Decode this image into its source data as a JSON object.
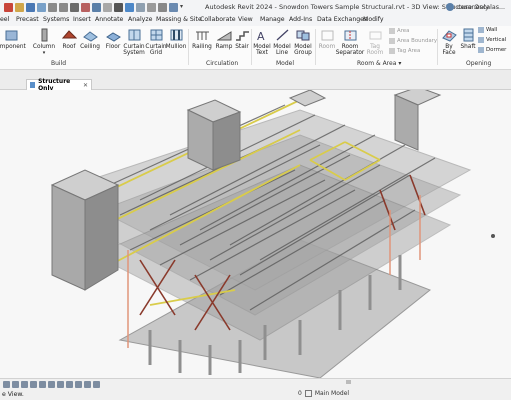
{
  "window": {
    "title": "Autodesk Revit 2024 - Snowdon Towers Sample Structural.rvt - 3D View: Structure Only",
    "user": "cesar.escalas..."
  },
  "menu": {
    "items": [
      "eel",
      "Precast",
      "Systems",
      "Insert",
      "Annotate",
      "Analyze",
      "Massing & Site",
      "Collaborate",
      "View",
      "Manage",
      "Add-Ins",
      "Modify"
    ],
    "data_exchanges": "Data Exchanges"
  },
  "ribbon": {
    "component": "omponent",
    "column": "Column",
    "roof": "Roof",
    "ceiling": "Ceiling",
    "floor": "Floor",
    "curtain_system": "Curtain System",
    "curtain_grid": "Curtain Grid",
    "mullion": "Mullion",
    "railing": "Railing",
    "ramp": "Ramp",
    "stair": "Stair",
    "model_text": "Model Text",
    "model_line": "Model Line",
    "model_group": "Model Group",
    "room": "Room",
    "room_separator": "Room Separator",
    "tag_room": "Tag Room",
    "area": "Area",
    "area_boundary": "Area Boundary",
    "tag_area": "Tag Area",
    "by_face": "By Face",
    "shaft": "Shaft",
    "wall": "Wall",
    "vertical": "Vertical",
    "dormer": "Dormer",
    "groups": {
      "build": "Build",
      "circulation": "Circulation",
      "model": "Model",
      "room_area": "Room & Area",
      "opening": "Opening"
    }
  },
  "view_tab": {
    "label": "Structure Only"
  },
  "status": {
    "prompt": "e View.",
    "model": "Main Model",
    "zero": "0"
  }
}
